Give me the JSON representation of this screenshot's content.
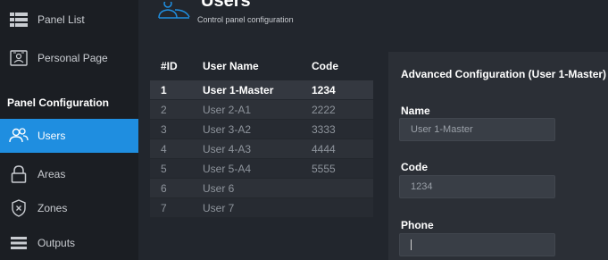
{
  "sidebar": {
    "items": [
      {
        "label": "Panel List",
        "icon": "list-icon"
      },
      {
        "label": "Personal Page",
        "icon": "id-card-icon"
      }
    ],
    "section_title": "Panel Configuration",
    "config_items": [
      {
        "label": "Users",
        "icon": "users-icon",
        "active": true
      },
      {
        "label": "Areas",
        "icon": "lock-icon"
      },
      {
        "label": "Zones",
        "icon": "shield-icon"
      },
      {
        "label": "Outputs",
        "icon": "outputs-icon"
      }
    ]
  },
  "header": {
    "title": "Users",
    "subtitle": "Control panel configuration",
    "icon": "users-icon"
  },
  "table": {
    "columns": [
      "#ID",
      "User Name",
      "Code"
    ],
    "rows": [
      {
        "id": "1",
        "name": "User 1-Master",
        "code": "1234"
      },
      {
        "id": "2",
        "name": "User 2-A1",
        "code": "2222"
      },
      {
        "id": "3",
        "name": "User 3-A2",
        "code": "3333"
      },
      {
        "id": "4",
        "name": "User 4-A3",
        "code": "4444"
      },
      {
        "id": "5",
        "name": "User 5-A4",
        "code": "5555"
      },
      {
        "id": "6",
        "name": "User 6",
        "code": ""
      },
      {
        "id": "7",
        "name": "User 7",
        "code": ""
      }
    ]
  },
  "config_panel": {
    "title": "Advanced Configuration (User 1-Master)",
    "name_label": "Name",
    "name_value": "User 1-Master",
    "code_label": "Code",
    "code_value": "1234",
    "phone_label": "Phone",
    "phone_value": ""
  },
  "colors": {
    "accent": "#1f8ee0",
    "sidebar_bg": "#1b1e23",
    "content_bg": "#22262d"
  }
}
